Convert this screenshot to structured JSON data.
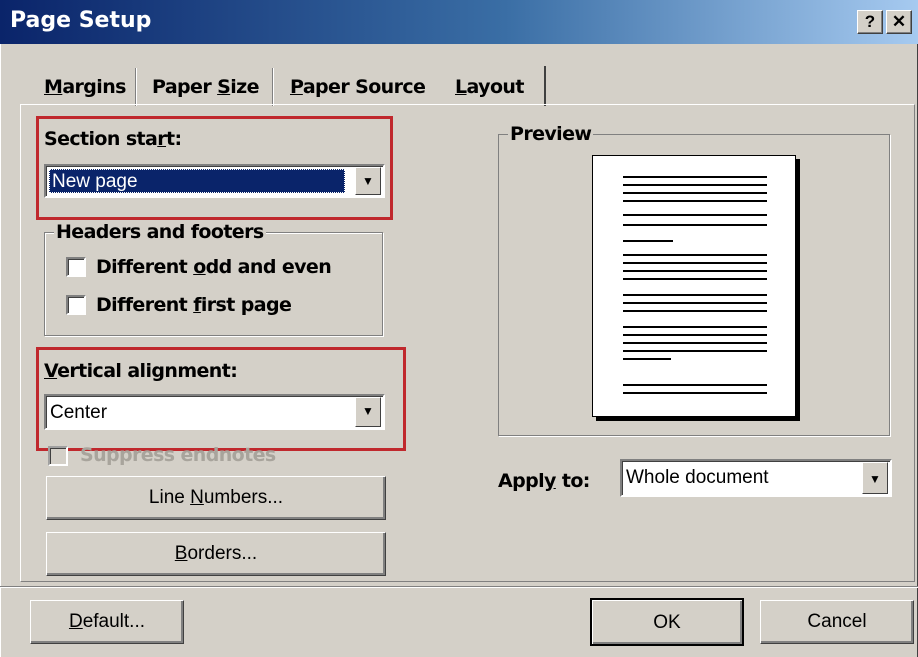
{
  "window": {
    "title": "Page Setup",
    "help_label": "?",
    "close_label": "✕"
  },
  "tabs": [
    {
      "pre": "",
      "u": "M",
      "post": "argins",
      "active": false
    },
    {
      "pre": "Paper ",
      "u": "S",
      "post": "ize",
      "active": false
    },
    {
      "pre": "",
      "u": "P",
      "post": "aper Source",
      "active": false
    },
    {
      "pre": "",
      "u": "L",
      "post": "ayout",
      "active": true
    }
  ],
  "section_start": {
    "label_pre": "Section sta",
    "label_u": "r",
    "label_post": "t:",
    "value": "New page"
  },
  "headers_footers": {
    "legend": "Headers and footers",
    "odd_even": {
      "pre": "Different ",
      "u": "o",
      "post": "dd and even",
      "checked": false
    },
    "first_page": {
      "pre": "Different ",
      "u": "f",
      "post": "irst page",
      "checked": false
    }
  },
  "vertical_alignment": {
    "label_pre": "",
    "label_u": "V",
    "label_post": "ertical alignment:",
    "value": "Center"
  },
  "suppress_endnotes": {
    "label": "Suppress endnotes",
    "enabled": false,
    "checked": false
  },
  "buttons": {
    "line_numbers": {
      "pre": "Line ",
      "u": "N",
      "post": "umbers..."
    },
    "borders": {
      "pre": "",
      "u": "B",
      "post": "orders..."
    },
    "default": {
      "pre": "",
      "u": "D",
      "post": "efault..."
    },
    "ok": "OK",
    "cancel": "Cancel"
  },
  "preview": {
    "legend": "Preview"
  },
  "apply_to": {
    "label_pre": "Appl",
    "label_u": "y",
    "label_post": " to:",
    "value": "Whole document"
  },
  "colors": {
    "highlight": "#c0282d",
    "selection": "#0a246a",
    "face": "#d4d0c8"
  }
}
